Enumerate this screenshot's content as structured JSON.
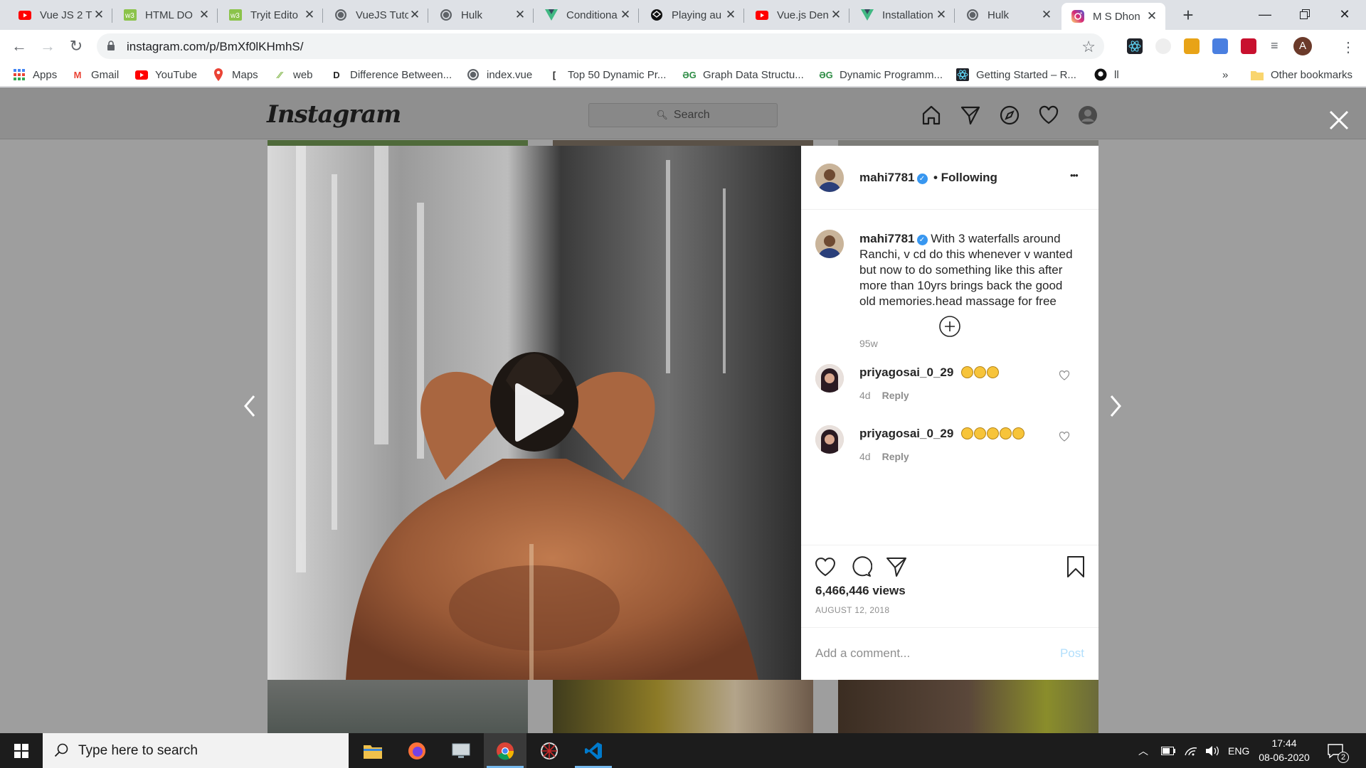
{
  "browser": {
    "tabs": [
      {
        "label": "Vue JS 2 T",
        "icon": "youtube-icon"
      },
      {
        "label": "HTML DO",
        "icon": "w3schools-icon"
      },
      {
        "label": "Tryit Edito",
        "icon": "w3schools-icon"
      },
      {
        "label": "VueJS Tuto",
        "icon": "globe-icon"
      },
      {
        "label": "Hulk",
        "icon": "globe-icon"
      },
      {
        "label": "Conditiona",
        "icon": "vue-icon"
      },
      {
        "label": "Playing au",
        "icon": "codepen-icon"
      },
      {
        "label": "Vue.js Den",
        "icon": "youtube-icon"
      },
      {
        "label": "Installation",
        "icon": "vue-icon"
      },
      {
        "label": "Hulk",
        "icon": "globe-icon"
      },
      {
        "label": "M S Dhon",
        "icon": "instagram-icon",
        "active": true
      }
    ],
    "new_tab_label": "+",
    "url": "instagram.com/p/BmXf0lKHmhS/",
    "profile_initial": "A",
    "bookmarks": [
      {
        "label": "Apps",
        "icon": "apps-grid-icon"
      },
      {
        "label": "Gmail",
        "icon": "gmail-icon"
      },
      {
        "label": "YouTube",
        "icon": "youtube-icon"
      },
      {
        "label": "Maps",
        "icon": "maps-icon"
      },
      {
        "label": "web",
        "icon": "web-icon"
      },
      {
        "label": "Difference Between...",
        "icon": "d-icon"
      },
      {
        "label": "index.vue",
        "icon": "globe-icon"
      },
      {
        "label": "Top 50 Dynamic Pr...",
        "icon": "bracket-icon"
      },
      {
        "label": "Graph Data Structu...",
        "icon": "gfg-icon"
      },
      {
        "label": "Dynamic Programm...",
        "icon": "gfg-icon"
      },
      {
        "label": "Getting Started – R...",
        "icon": "react-icon"
      },
      {
        "label": "ll",
        "icon": "github-icon"
      }
    ],
    "bookmarks_more": "»",
    "other_bookmarks": "Other bookmarks"
  },
  "instagram": {
    "logo": "Instagram",
    "search_placeholder": "Search",
    "post": {
      "username": "mahi7781",
      "follow_status": "• Following",
      "more_label": "•••",
      "caption": "With 3 waterfalls around Ranchi, v cd do this whenever v wanted but now to do something like this after more than 10yrs brings back the good old memories.head massage for free",
      "caption_age": "95w",
      "comments": [
        {
          "username": "priyagosai_0_29",
          "emoji_count": 3,
          "emoji_kind": "ok-hand",
          "age": "4d",
          "reply": "Reply"
        },
        {
          "username": "priyagosai_0_29",
          "emoji_count": 5,
          "emoji_kind": "astonished-face",
          "age": "4d",
          "reply": "Reply"
        }
      ],
      "views": "6,466,446 views",
      "date": "AUGUST 12, 2018",
      "add_comment_placeholder": "Add a comment...",
      "post_button": "Post"
    }
  },
  "taskbar": {
    "search_placeholder": "Type here to search",
    "language": "ENG",
    "time": "17:44",
    "date": "08-06-2020",
    "notification_count": "2"
  },
  "colors": {
    "chrome_bg": "#dee1e6",
    "ig_overlay": "#9e9e9e",
    "ig_link_blue": "#3897f0",
    "taskbar_bg": "#1c1c1c"
  }
}
